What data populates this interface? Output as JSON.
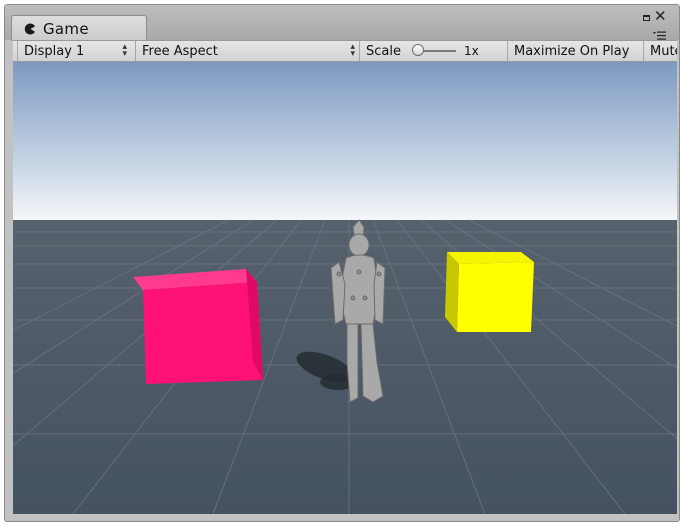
{
  "window": {
    "tab_title": "Game",
    "tab_icon": "pacman-icon"
  },
  "toolbar": {
    "display_label": "Display 1",
    "aspect_label": "Free Aspect",
    "scale_label": "Scale",
    "scale_value": "1x",
    "scale_slider_fraction": 0,
    "maximize_on_play_label": "Maximize On Play",
    "mute_label": "Mute"
  },
  "colors": {
    "sky_top": "#7f9bc3",
    "sky_horizon": "#f2f5f8",
    "ground": "#4a5562",
    "pink_cube": "#ff1177",
    "yellow_cube": "#ffff00",
    "character": "#a9a9a9"
  },
  "scene": {
    "objects": [
      "pink-cube",
      "yellow-cube",
      "armored-character",
      "character-shadow",
      "grid-floor"
    ]
  }
}
